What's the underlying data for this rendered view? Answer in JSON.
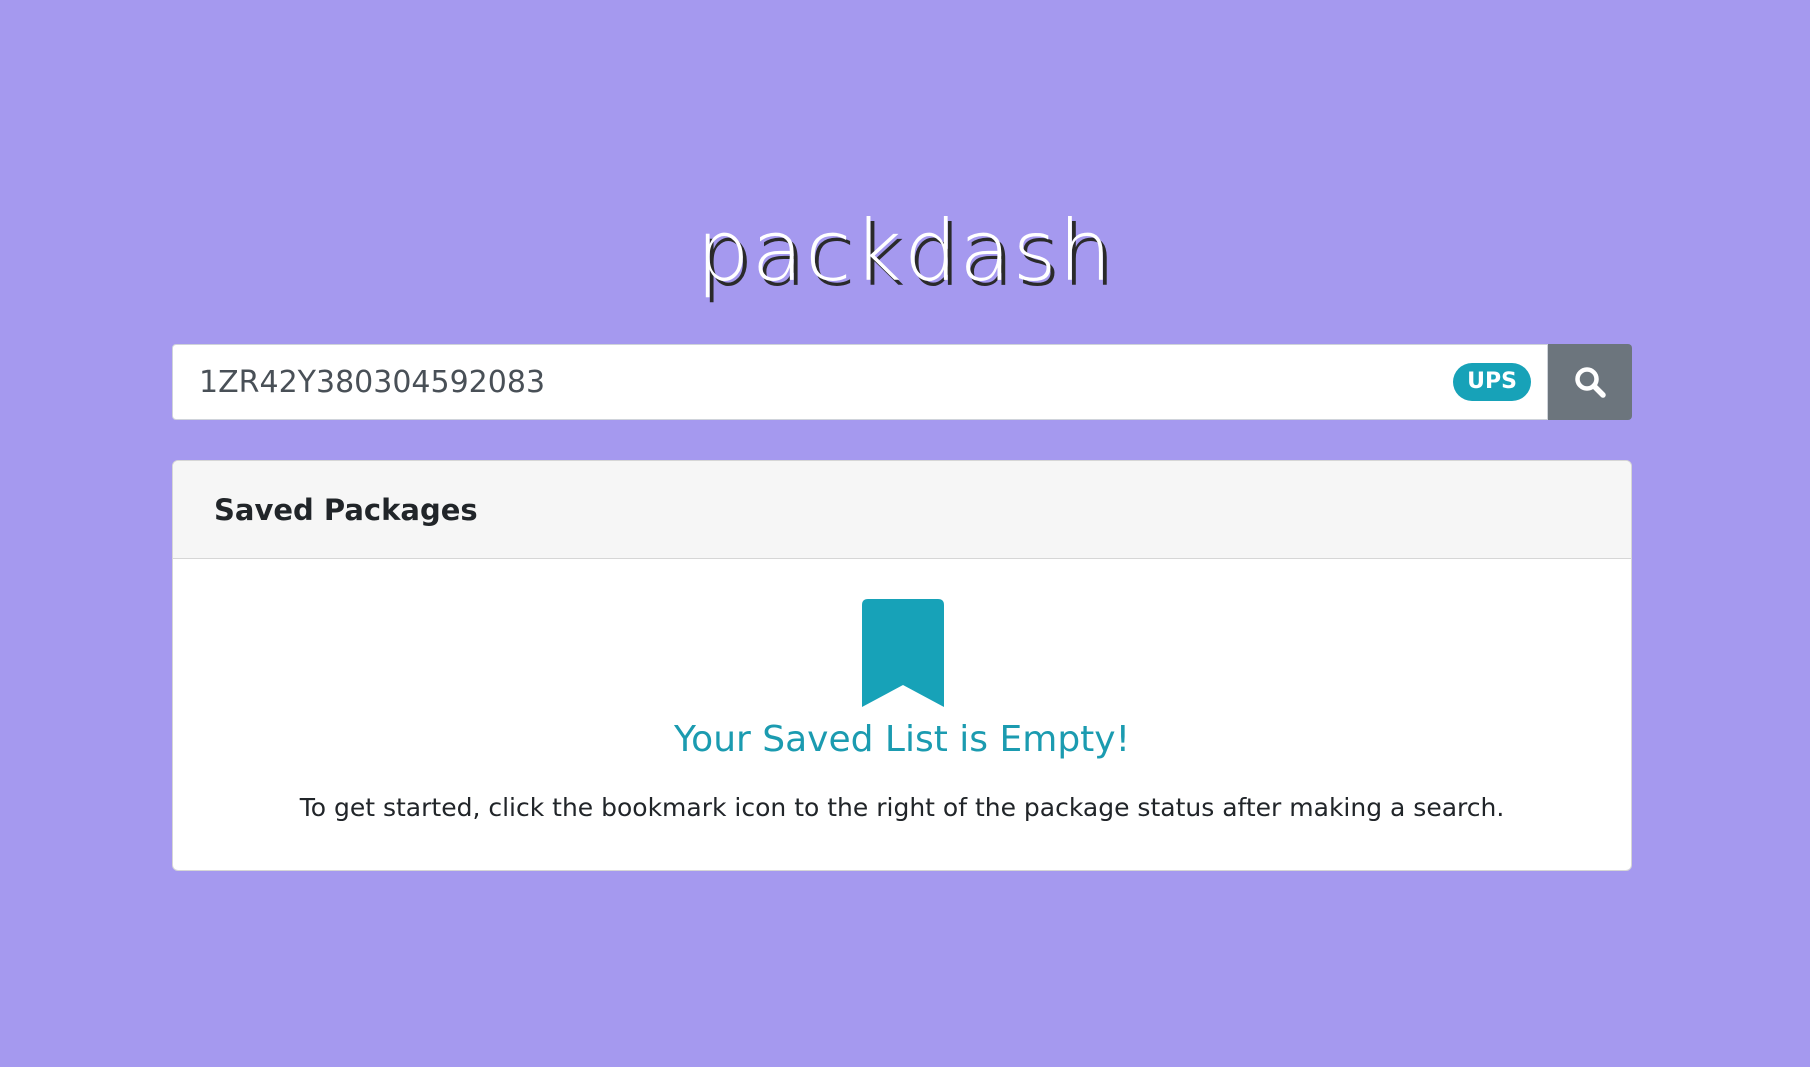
{
  "app": {
    "logo": "packdash"
  },
  "search": {
    "value": "1ZR42Y380304592083",
    "carrier_badge": "UPS",
    "button_icon": "search-icon"
  },
  "saved_packages": {
    "title": "Saved Packages",
    "empty_icon": "bookmark-icon",
    "empty_title": "Your Saved List is Empty!",
    "empty_hint": "To get started, click the bookmark icon to the right of the package status after making a search."
  },
  "colors": {
    "background": "#a599ef",
    "accent": "#17a2b8",
    "button": "#6c757d"
  }
}
